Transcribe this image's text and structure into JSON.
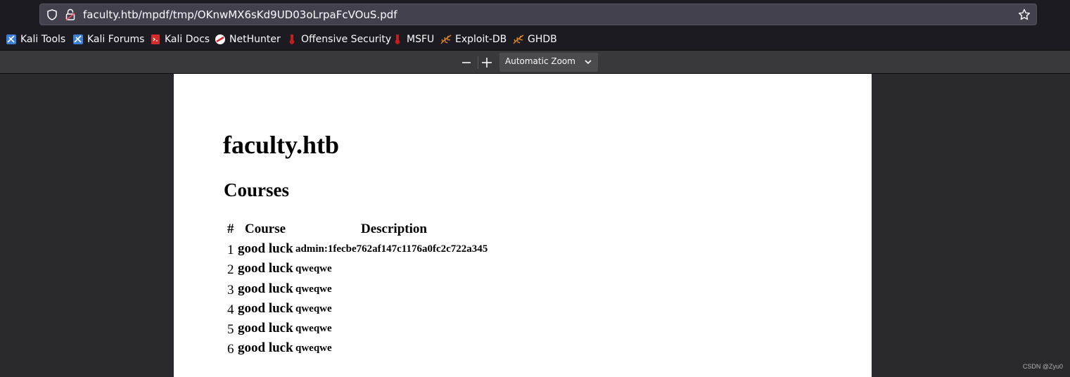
{
  "browser": {
    "url": "faculty.htb/mpdf/tmp/OKnwMX6sKd9UD03oLrpaFcVOuS.pdf"
  },
  "bookmarks": [
    {
      "label": "Kali Tools",
      "icon": "kali-icon"
    },
    {
      "label": "Kali Forums",
      "icon": "kali-icon"
    },
    {
      "label": "Kali Docs",
      "icon": "docs-icon"
    },
    {
      "label": "NetHunter",
      "icon": "nethunter-icon"
    },
    {
      "label": "Offensive Security",
      "icon": "offsec-icon"
    },
    {
      "label": "MSFU",
      "icon": "offsec-icon"
    },
    {
      "label": "Exploit-DB",
      "icon": "exploitdb-icon"
    },
    {
      "label": "GHDB",
      "icon": "exploitdb-icon"
    }
  ],
  "pdf_toolbar": {
    "zoom_label": "Automatic Zoom"
  },
  "document": {
    "title": "faculty.htb",
    "subtitle": "Courses",
    "headers": [
      "#",
      "Course",
      "Description"
    ],
    "rows": [
      {
        "num": "1",
        "course": "good luck",
        "description": "admin:1fecbe762af147c1176a0fc2c722a345"
      },
      {
        "num": "2",
        "course": "good luck",
        "description": "qweqwe"
      },
      {
        "num": "3",
        "course": "good luck",
        "description": "qweqwe"
      },
      {
        "num": "4",
        "course": "good luck",
        "description": "qweqwe"
      },
      {
        "num": "5",
        "course": "good luck",
        "description": "qweqwe"
      },
      {
        "num": "6",
        "course": "good luck",
        "description": "qweqwe"
      }
    ]
  },
  "watermark": "CSDN @Zyu0"
}
